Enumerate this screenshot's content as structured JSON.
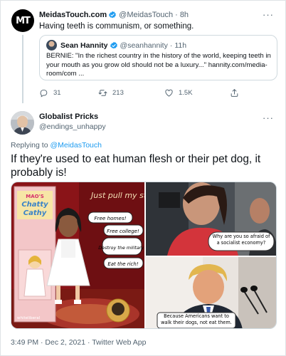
{
  "parent_tweet": {
    "avatar_text": "MT",
    "display_name": "MeidasTouch.com",
    "handle": "@MeidasTouch",
    "separator": "·",
    "time": "8h",
    "text": "Having teeth is communism, or something.",
    "quote": {
      "display_name": "Sean Hannity",
      "handle": "@seanhannity",
      "separator": "·",
      "time": "11h",
      "text": "BERNIE: \"In the richest country in the history of the world, keeping teeth in your mouth as you grow old should not be a luxury...\" hannity.com/media-room/com ..."
    },
    "actions": {
      "replies": "31",
      "retweets": "213",
      "likes": "1.5K"
    }
  },
  "reply_tweet": {
    "display_name": "Globalist Pricks",
    "handle": "@endings_unhappy",
    "replying_prefix": "Replying to",
    "replying_to": "@MeidasTouch",
    "text": "If they're used to eat human flesh or their pet dog, it probably is!",
    "meme": {
      "box_brand": "MAO'S",
      "box_title_1": "Chatty",
      "box_title_2": "Cathy",
      "headline": "Just pull my string",
      "bubbles": [
        "Free homes!",
        "Free college!",
        "Destroy the military!",
        "Eat the rich!"
      ],
      "credit": "whiteliberal",
      "question": "Why are you so afraid of a socialist economy?",
      "answer": "Because Americans want to walk their dogs, not eat them."
    },
    "footer": "3:49 PM · Dec 2, 2021 · Twitter Web App"
  },
  "colors": {
    "verified": "#1d9bf0",
    "link": "#1d9bf0",
    "muted": "#536471",
    "border": "#cfd9de"
  },
  "icons": {
    "verified": "verified-badge-icon",
    "more": "more-icon",
    "reply": "reply-icon",
    "retweet": "retweet-icon",
    "like": "heart-icon",
    "share": "share-icon"
  }
}
